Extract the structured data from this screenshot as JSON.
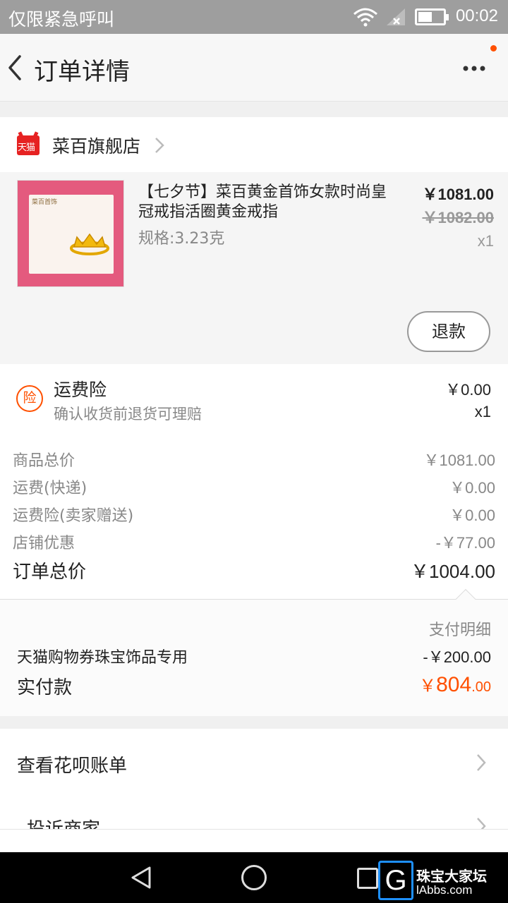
{
  "status_bar": {
    "carrier": "仅限紧急呼叫",
    "time": "00:02",
    "battery_level": 0.55
  },
  "header": {
    "title": "订单详情"
  },
  "shop": {
    "name": "菜百旗舰店",
    "logo_text": "天猫"
  },
  "product": {
    "image_brand": "菜百首饰",
    "title": "【七夕节】菜百黄金首饰女款时尚皇冠戒指活圈黄金戒指",
    "spec": "规格:3.23克",
    "price": "￥1081.00",
    "original_price": "￥1082.00",
    "quantity": "x1",
    "refund_label": "退款"
  },
  "insurance": {
    "icon_text": "险",
    "name": "运费险",
    "description": "确认收货前退货可理赔",
    "amount": "￥0.00",
    "quantity": "x1"
  },
  "summary": {
    "rows": [
      {
        "label": "商品总价",
        "value": "￥1081.00"
      },
      {
        "label": "运费(快递)",
        "value": "￥0.00"
      },
      {
        "label": "运费险(卖家赠送)",
        "value": "￥0.00"
      },
      {
        "label": "店铺优惠",
        "value": "-￥77.00"
      }
    ],
    "total_label": "订单总价",
    "total_value": "￥1004.00"
  },
  "payment": {
    "detail_label": "支付明细",
    "coupon_label": "天猫购物券珠宝饰品专用",
    "coupon_value": "-￥200.00",
    "paid_label": "实付款",
    "paid_currency": "￥",
    "paid_integer": "804",
    "paid_decimal": ".00"
  },
  "links": {
    "items": [
      {
        "label": "查看花呗账单"
      },
      {
        "label": "投诉商家"
      }
    ]
  },
  "watermark": {
    "letter": "G",
    "line1": "珠宝大家坛",
    "line2": "lAbbs.com"
  },
  "colors": {
    "accent": "#ff5000",
    "tmall_red": "#e62222",
    "status_bar": "#9e9e9e"
  }
}
